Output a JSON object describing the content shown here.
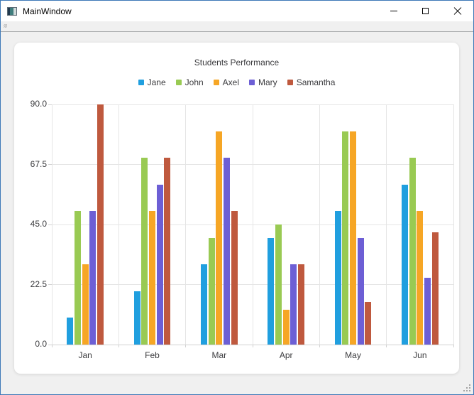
{
  "window": {
    "title": "MainWindow"
  },
  "chart_data": {
    "type": "bar",
    "title": "Students Performance",
    "categories": [
      "Jan",
      "Feb",
      "Mar",
      "Apr",
      "May",
      "Jun"
    ],
    "series": [
      {
        "name": "Jane",
        "color": "#209fdf",
        "values": [
          10,
          20,
          30,
          40,
          50,
          60
        ]
      },
      {
        "name": "John",
        "color": "#99ca53",
        "values": [
          50,
          70,
          40,
          45,
          80,
          70
        ]
      },
      {
        "name": "Axel",
        "color": "#f6a625",
        "values": [
          30,
          50,
          80,
          13,
          80,
          50
        ]
      },
      {
        "name": "Mary",
        "color": "#6d5fd5",
        "values": [
          50,
          60,
          70,
          30,
          40,
          25
        ]
      },
      {
        "name": "Samantha",
        "color": "#bf593e",
        "values": [
          90,
          70,
          50,
          30,
          16,
          42
        ]
      }
    ],
    "ylim": [
      0,
      90
    ],
    "yticks": [
      {
        "label": "90.0",
        "value": 90
      },
      {
        "label": "67.5",
        "value": 67.5
      },
      {
        "label": "45.0",
        "value": 45
      },
      {
        "label": "22.5",
        "value": 22.5
      },
      {
        "label": "0.0",
        "value": 0
      }
    ],
    "grid": true,
    "legend_position": "top"
  }
}
